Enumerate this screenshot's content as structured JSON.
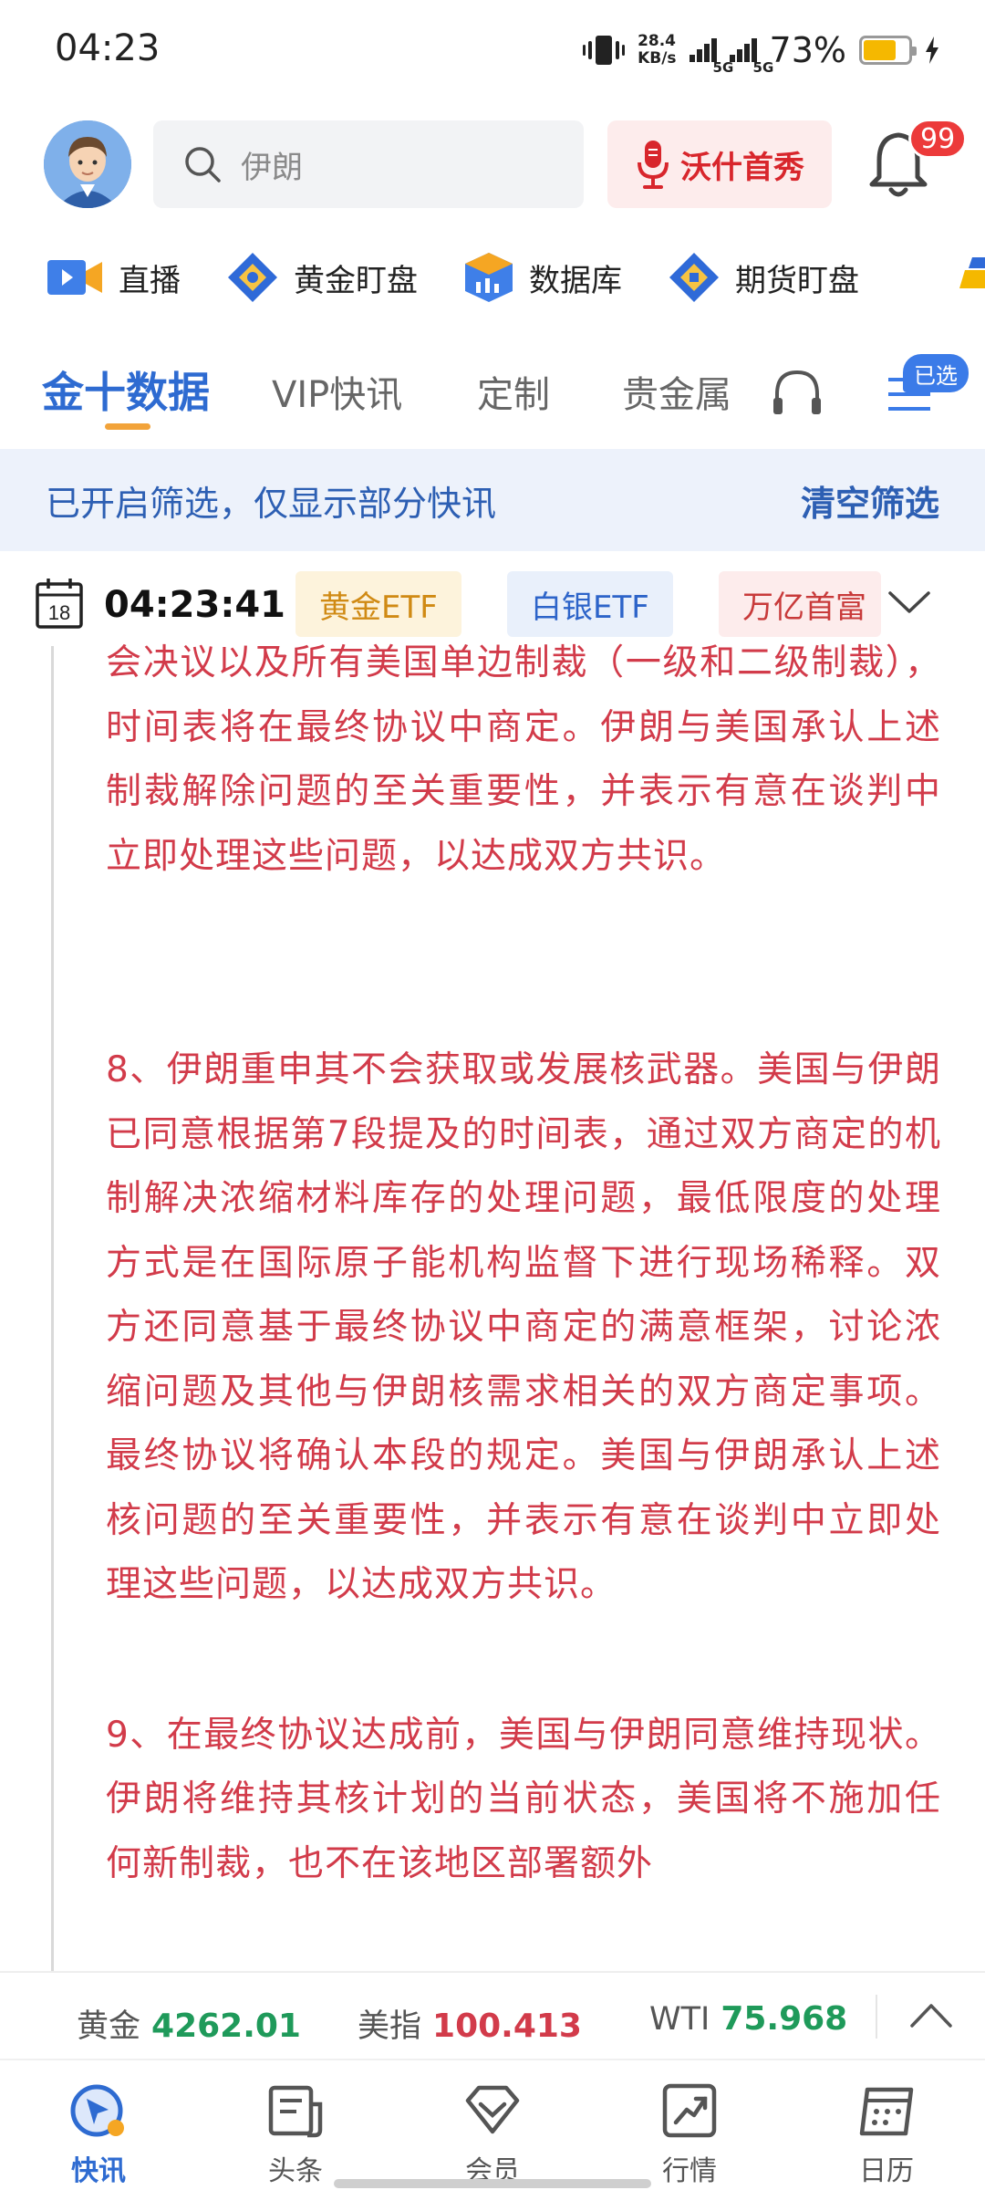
{
  "status_bar": {
    "time": "04:23",
    "net_speed_value": "28.4",
    "net_speed_unit": "KB/s",
    "sim1": "5G",
    "sim2": "5G",
    "battery": "73%",
    "battery_level": 0.73,
    "battery_color": "#f5b800"
  },
  "header": {
    "search_placeholder": "伊朗",
    "promo_label": "沃什首秀",
    "notification_count": "99"
  },
  "shortcuts": [
    {
      "label": "直播",
      "icon": "video-camera-icon"
    },
    {
      "label": "黄金盯盘",
      "icon": "gold-watch-icon"
    },
    {
      "label": "数据库",
      "icon": "database-icon"
    },
    {
      "label": "期货盯盘",
      "icon": "futures-watch-icon"
    }
  ],
  "tabs": {
    "items": [
      "金十数据",
      "VIP快讯",
      "定制",
      "贵金属"
    ],
    "active_index": 0,
    "selected_badge": "已选",
    "accent": "#2e6bd1"
  },
  "filter_banner": {
    "message": "已开启筛选，仅显示部分快讯",
    "clear_label": "清空筛选"
  },
  "news_header": {
    "calendar_day": "18",
    "timestamp": "04:23:41",
    "tags": [
      "黄金ETF",
      "白银ETF",
      "万亿首富"
    ]
  },
  "article": {
    "color": "#d23b4a",
    "paragraphs": [
      "会决议以及所有美国单边制裁（一级和二级制裁），时间表将在最终协议中商定。伊朗与美国承认上述制裁解除问题的至关重要性，并表示有意在谈判中立即处理这些问题，以达成双方共识。",
      "8、伊朗重申其不会获取或发展核武器。美国与伊朗已同意根据第7段提及的时间表，通过双方商定的机制解决浓缩材料库存的处理问题，最低限度的处理方式是在国际原子能机构监督下进行现场稀释。双方还同意基于最终协议中商定的满意框架，讨论浓缩问题及其他与伊朗核需求相关的双方商定事项。最终协议将确认本段的规定。美国与伊朗承认上述核问题的至关重要性，并表示有意在谈判中立即处理这些问题，以达成双方共识。",
      "9、在最终协议达成前，美国与伊朗同意维持现状。伊朗将维持其核计划的当前状态，美国将不施加任何新制裁，也不在该地区部署额外"
    ]
  },
  "ticker": [
    {
      "name": "黄金",
      "value": "4262.01",
      "trend_color": "#1f9a5a"
    },
    {
      "name": "美指",
      "value": "100.413",
      "trend_color": "#d23b4a"
    },
    {
      "name": "WTI",
      "value": "75.968",
      "trend_color": "#1f9a5a"
    }
  ],
  "bottom_nav": [
    {
      "label": "快讯",
      "icon": "flash-news-icon",
      "active": true
    },
    {
      "label": "头条",
      "icon": "headline-icon",
      "active": false
    },
    {
      "label": "会员",
      "icon": "vip-icon",
      "active": false
    },
    {
      "label": "行情",
      "icon": "market-icon",
      "active": false
    },
    {
      "label": "日历",
      "icon": "calendar-icon",
      "active": false
    }
  ]
}
